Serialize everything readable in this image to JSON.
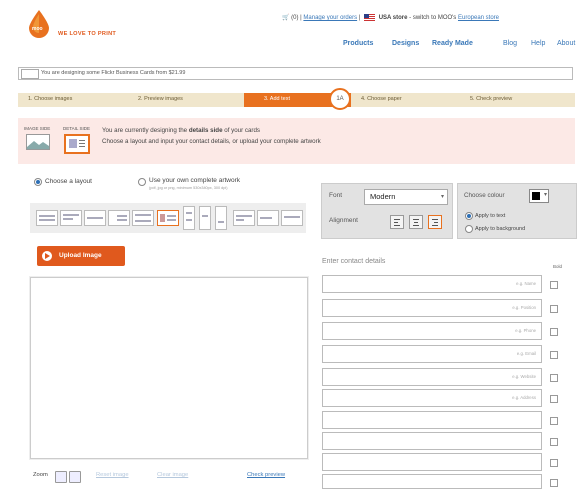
{
  "header": {
    "tagline": "WE LOVE TO PRINT",
    "logo_text": "moo",
    "cart": "(0)",
    "separator": "|",
    "manage_orders": "Manage your orders",
    "store_label": "USA store",
    "switch_text": "- switch to MOO's",
    "european_store": "European store",
    "nav_primary": [
      "Products",
      "Designs",
      "Ready Made"
    ],
    "nav_secondary": [
      "Blog",
      "Help",
      "About"
    ]
  },
  "designing_text": "You are designing some Flickr Business Cards from $21.99",
  "steps": [
    {
      "label": "1. Choose images"
    },
    {
      "label": "2. Preview images"
    },
    {
      "label": "3. Add text"
    },
    {
      "label": "4. Choose paper"
    },
    {
      "label": "5. Check preview"
    }
  ],
  "step_badge": "1A",
  "info": {
    "image_side": "IMAGE SIDE",
    "detail_side": "DETAIL SIDE",
    "line1_a": "You are currently designing the",
    "line1_b": "details side",
    "line1_c": "of your cards",
    "line2": "Choose a layout and input your contact details, or upload your complete artwork"
  },
  "layout_options": {
    "choose_layout": "Choose a layout",
    "own_artwork": "Use your own complete artwork",
    "own_artwork_sub": "(pdf, jpg or png, minimum 530x340px, 300 dpi)"
  },
  "upload_button": "Upload Image",
  "zoom": {
    "label": "Zoom",
    "reset": "Reset image",
    "clear": "Clear image",
    "check": "Check preview"
  },
  "font_panel": {
    "font_label": "Font",
    "font_value": "Modern",
    "alignment_label": "Alignment"
  },
  "colour_panel": {
    "title": "Choose colour",
    "apply_text": "Apply to text",
    "apply_background": "Apply to background",
    "swatch_color": "#000000"
  },
  "contact": {
    "title": "Enter contact details",
    "bold_label": "Bold",
    "fields": [
      "e.g. Name",
      "e.g. Position",
      "e.g. Phone",
      "e.g. Email",
      "e.g. Website",
      "e.g. Address",
      "",
      "",
      "",
      ""
    ]
  },
  "colors": {
    "accent": "#e8711f",
    "link": "#3a78b8",
    "info_bg": "#fce9e6"
  }
}
